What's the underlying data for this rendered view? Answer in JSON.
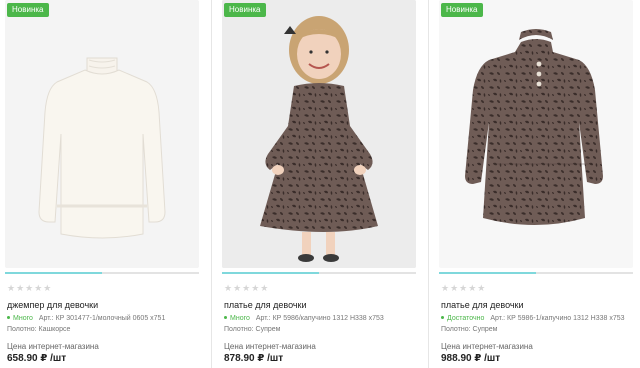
{
  "products": [
    {
      "badge": "Новинка",
      "rating": "★★★★★",
      "progress": 0.5,
      "name": "джемпер для девочки",
      "stock": "Много",
      "article": "Арт.: КР 301477-1/молочный 0605 х751",
      "fabric": "Полотно: Кашкорсе",
      "price_label": "Цена интернет-магазина",
      "price": "658.90 ₽ /шт",
      "icon": "white-turtleneck-sweater"
    },
    {
      "badge": "Новинка",
      "rating": "★★★★★",
      "progress": 0.5,
      "name": "платье для девочки",
      "stock": "Много",
      "article": "Арт.: КР 5986/капучино 1312 Н338 х753",
      "fabric": "Полотно: Супрем",
      "price_label": "Цена интернет-магазина",
      "price": "878.90 ₽ /шт",
      "icon": "girl-in-leopard-dress"
    },
    {
      "badge": "Новинка",
      "rating": "★★★★★",
      "progress": 0.5,
      "name": "платье для девочки",
      "stock": "Достаточно",
      "article": "Арт.: КР 5986-1/капучино 1312 Н338 х753",
      "fabric": "Полотно: Супрем",
      "price_label": "Цена интернет-магазина",
      "price": "988.90 ₽ /шт",
      "icon": "leopard-dress"
    }
  ],
  "colors": {
    "badge": "#4cb74a",
    "stock": "#4cb74a",
    "progress_fill": "#7fd8dc",
    "leopard_base": "#6f5c56",
    "leopard_spot": "#3a2d2a"
  }
}
